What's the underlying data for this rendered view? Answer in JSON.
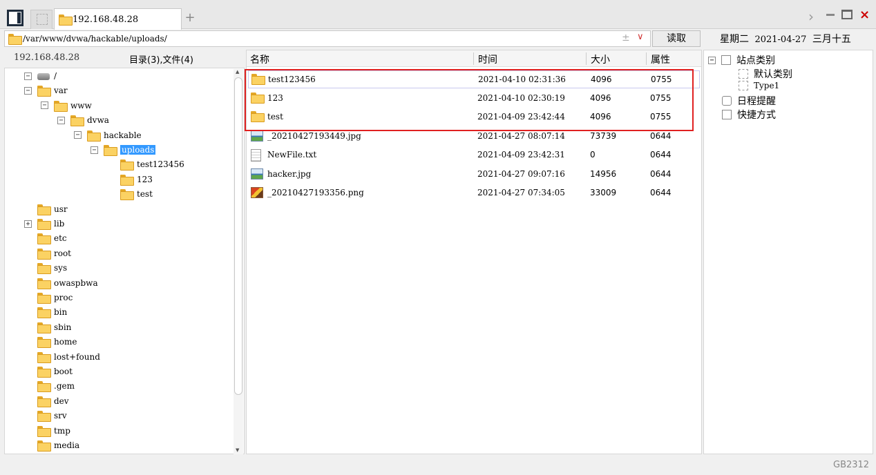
{
  "window": {
    "tab_title": "192.168.48.28",
    "add_tab": "+",
    "close": "×"
  },
  "pathbar": {
    "path": "/var/www/dvwa/hackable/uploads/",
    "plusminus": "±",
    "dropdown": "∨",
    "read_button": "读取"
  },
  "date": {
    "weekday": "星期二",
    "date": "2021-04-27",
    "lunar": "三月十五"
  },
  "left": {
    "ip": "192.168.48.28",
    "counts": "目录(3),文件(4)"
  },
  "tree": [
    {
      "label": "/",
      "exp": "−",
      "icon": "drive"
    },
    {
      "label": "var",
      "exp": "−"
    },
    {
      "label": "www",
      "exp": "−"
    },
    {
      "label": "dvwa",
      "exp": "−"
    },
    {
      "label": "hackable",
      "exp": "−"
    },
    {
      "label": "uploads",
      "exp": "−",
      "selected": true
    },
    {
      "label": "test123456"
    },
    {
      "label": "123"
    },
    {
      "label": "test"
    },
    {
      "label": "usr"
    },
    {
      "label": "lib",
      "exp": "+"
    },
    {
      "label": "etc"
    },
    {
      "label": "root"
    },
    {
      "label": "sys"
    },
    {
      "label": "owaspbwa"
    },
    {
      "label": "proc"
    },
    {
      "label": "bin"
    },
    {
      "label": "sbin"
    },
    {
      "label": "home"
    },
    {
      "label": "lost+found"
    },
    {
      "label": "boot"
    },
    {
      "label": ".gem"
    },
    {
      "label": "dev"
    },
    {
      "label": "srv"
    },
    {
      "label": "tmp"
    },
    {
      "label": "media"
    }
  ],
  "list": {
    "headers": {
      "name": "名称",
      "time": "时间",
      "size": "大小",
      "perm": "属性"
    },
    "rows": [
      {
        "name": "test123456",
        "time": "2021-04-10 02:31:36",
        "size": "4096",
        "perm": "0755",
        "icon": "folder"
      },
      {
        "name": "123",
        "time": "2021-04-10 02:30:19",
        "size": "4096",
        "perm": "0755",
        "icon": "folder"
      },
      {
        "name": "test",
        "time": "2021-04-09 23:42:44",
        "size": "4096",
        "perm": "0755",
        "icon": "folder"
      },
      {
        "name": "_20210427193449.jpg",
        "time": "2021-04-27 08:07:14",
        "size": "73739",
        "perm": "0644",
        "icon": "img"
      },
      {
        "name": "NewFile.txt",
        "time": "2021-04-09 23:42:31",
        "size": "0",
        "perm": "0644",
        "icon": "txt"
      },
      {
        "name": "hacker.jpg",
        "time": "2021-04-27 09:07:16",
        "size": "14956",
        "perm": "0644",
        "icon": "img"
      },
      {
        "name": "_20210427193356.png",
        "time": "2021-04-27 07:34:05",
        "size": "33009",
        "perm": "0644",
        "icon": "png"
      }
    ]
  },
  "right": {
    "site_category": "站点类别",
    "default_category": "默认类别",
    "type1": "Type1",
    "schedule": "日程提醒",
    "shortcuts": "快捷方式"
  },
  "status": {
    "encoding": "GB2312"
  },
  "colors": {
    "highlight_box": "#e02020",
    "selection": "#3399ff",
    "folder": "#fbd263"
  }
}
